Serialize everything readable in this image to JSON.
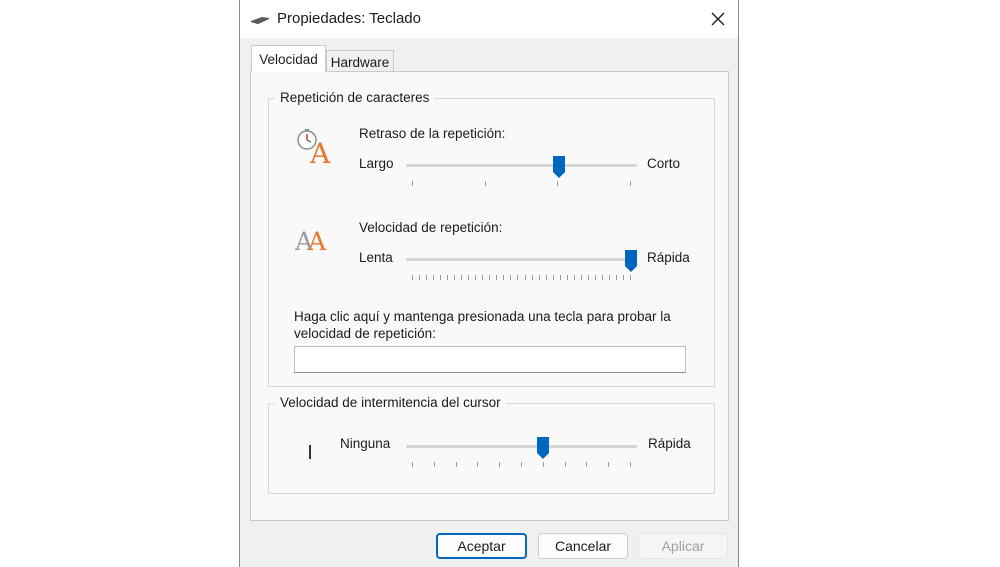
{
  "window": {
    "title": "Propiedades: Teclado",
    "close_glyph": "✕"
  },
  "tabs": [
    {
      "label": "Velocidad",
      "active": true
    },
    {
      "label": "Hardware",
      "active": false
    }
  ],
  "char_repeat": {
    "group_label": "Repetición de caracteres",
    "delay": {
      "label": "Retraso de la repetición:",
      "min_label": "Largo",
      "max_label": "Corto",
      "ticks": 4,
      "value": 0.67,
      "icon": "repeat-delay-icon"
    },
    "rate": {
      "label": "Velocidad de repetición:",
      "min_label": "Lenta",
      "max_label": "Rápida",
      "ticks": 32,
      "value": 1.0,
      "icon": "repeat-rate-icon"
    },
    "test_label": "Haga clic aquí y mantenga presionada una tecla para probar la velocidad de repetición:",
    "test_value": ""
  },
  "cursor_blink": {
    "group_label": "Velocidad de intermitencia del cursor",
    "min_label": "Ninguna",
    "max_label": "Rápida",
    "ticks": 11,
    "value": 0.6,
    "icon": "cursor-icon"
  },
  "buttons": {
    "ok": "Aceptar",
    "cancel": "Cancelar",
    "apply": "Aplicar"
  },
  "colors": {
    "accent": "#0067c0",
    "icon_orange": "#e8772e",
    "icon_gray": "#9a9a9a"
  }
}
